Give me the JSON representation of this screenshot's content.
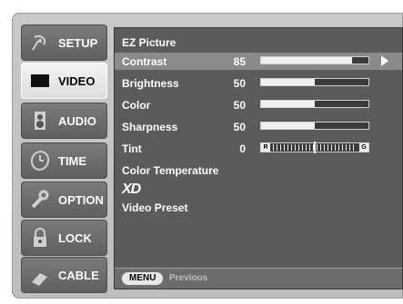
{
  "menu": {
    "items": [
      {
        "label": "SETUP",
        "icon": "satellite-dish-icon",
        "selected": false
      },
      {
        "label": "VIDEO",
        "icon": "tv-screen-icon",
        "selected": true
      },
      {
        "label": "AUDIO",
        "icon": "speaker-icon",
        "selected": false
      },
      {
        "label": "TIME",
        "icon": "clock-icon",
        "selected": false
      },
      {
        "label": "OPTION",
        "icon": "wrench-icon",
        "selected": false
      },
      {
        "label": "LOCK",
        "icon": "padlock-icon",
        "selected": false
      },
      {
        "label": "CABLE",
        "icon": "cable-connector-icon",
        "selected": false
      }
    ]
  },
  "panel": {
    "title": "EZ Picture",
    "rows": [
      {
        "label": "Contrast",
        "value": "85",
        "level": 0.85,
        "highlighted": true
      },
      {
        "label": "Brightness",
        "value": "50",
        "level": 0.5
      },
      {
        "label": "Color",
        "value": "50",
        "level": 0.5
      },
      {
        "label": "Sharpness",
        "value": "50",
        "level": 0.5
      },
      {
        "label": "Tint",
        "value": "0",
        "left_cap": "R",
        "right_cap": "G"
      }
    ],
    "extra_items": [
      "Color Temperature",
      "XD",
      "Video Preset"
    ],
    "footer": {
      "key": "MENU",
      "text": "Previous"
    }
  },
  "colors": {
    "panel_bg": "#5b5b5b",
    "highlight": "#8a8a8a",
    "selected_menu": "#e6e6e6"
  }
}
